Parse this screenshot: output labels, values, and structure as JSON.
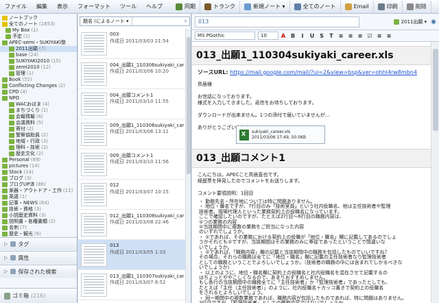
{
  "menu": [
    "ファイル",
    "編集",
    "表示",
    "フォーマット",
    "ツール",
    "ヘルプ"
  ],
  "toolbar": [
    {
      "label": "同期",
      "icon": "sync-icon",
      "color": "#5a8a3a"
    },
    {
      "label": "トランク",
      "icon": "trunk-icon",
      "color": "#7a5a2a"
    },
    {
      "label": "新規ノート ▾",
      "icon": "new-note-icon",
      "color": "#6a9ad0"
    },
    {
      "label": "全てのノート",
      "icon": "all-notes-icon",
      "color": "#5f7fa8"
    },
    {
      "label": "Email",
      "icon": "email-icon",
      "color": "#d0a040"
    },
    {
      "label": "印刷",
      "icon": "print-icon",
      "color": "#6a7b8c"
    },
    {
      "label": "削除",
      "icon": "delete-icon",
      "color": "#8a8a8a"
    }
  ],
  "tree": [
    {
      "label": "ノートブック",
      "indent": 0,
      "icon": "y",
      "count": "",
      "sel": false
    },
    {
      "label": "全てのノート",
      "indent": 0,
      "icon": "y",
      "count": "(1853)",
      "sel": false
    },
    {
      "label": "My Box",
      "indent": 1,
      "icon": "g",
      "count": "(1)",
      "sel": false
    },
    {
      "label": "予定",
      "indent": 1,
      "icon": "g",
      "count": "(1)",
      "sel": false
    },
    {
      "label": "APEC-semi・SUKIYAKI塾",
      "indent": 0,
      "icon": "g",
      "count": "",
      "sel": false
    },
    {
      "label": "2011出願",
      "indent": 2,
      "icon": "g",
      "count": "(7)",
      "sel": true
    },
    {
      "label": "base",
      "indent": 2,
      "icon": "g",
      "count": "(24)",
      "sel": false
    },
    {
      "label": "SUKIYAKI2010",
      "indent": 2,
      "icon": "g",
      "count": "(15)",
      "sel": false
    },
    {
      "label": "zemi2010",
      "indent": 2,
      "icon": "g",
      "count": "(12)",
      "sel": false
    },
    {
      "label": "管理",
      "indent": 2,
      "icon": "g",
      "count": "(1)",
      "sel": false
    },
    {
      "label": "Book",
      "indent": 0,
      "icon": "g",
      "count": "(52)",
      "sel": false
    },
    {
      "label": "Conflicting Changes",
      "indent": 0,
      "icon": "g",
      "count": "(2)",
      "sel": false
    },
    {
      "label": "CPD",
      "indent": 0,
      "icon": "g",
      "count": "(4)",
      "sel": false
    },
    {
      "label": "NPO",
      "indent": 0,
      "icon": "g",
      "count": "",
      "sel": false
    },
    {
      "label": "WACおばま",
      "indent": 2,
      "icon": "g",
      "count": "(4)",
      "sel": false
    },
    {
      "label": "まちづくり",
      "indent": 2,
      "icon": "g",
      "count": "(1)",
      "sel": false
    },
    {
      "label": "会報情報",
      "indent": 2,
      "icon": "g",
      "count": "(6)",
      "sel": false
    },
    {
      "label": "会議資料",
      "indent": 2,
      "icon": "g",
      "count": "(5)",
      "sel": false
    },
    {
      "label": "寄付",
      "indent": 2,
      "icon": "g",
      "count": "(2)",
      "sel": false
    },
    {
      "label": "警察協助員",
      "indent": 2,
      "icon": "g",
      "count": "(2)",
      "sel": false
    },
    {
      "label": "地域・行政",
      "indent": 2,
      "icon": "g",
      "count": "(3)",
      "sel": false
    },
    {
      "label": "理科・技術",
      "indent": 2,
      "icon": "g",
      "count": "(2)",
      "sel": false
    },
    {
      "label": "歴史文化",
      "indent": 2,
      "icon": "g",
      "count": "(2)",
      "sel": false
    },
    {
      "label": "Personal",
      "indent": 0,
      "icon": "g",
      "count": "(89)",
      "sel": false
    },
    {
      "label": "pictures",
      "indent": 0,
      "icon": "g",
      "count": "(14)",
      "sel": false
    },
    {
      "label": "Stock",
      "indent": 0,
      "icon": "g",
      "count": "(14)",
      "sel": false
    },
    {
      "label": "ブログ",
      "indent": 0,
      "icon": "g",
      "count": "(3)",
      "sel": false
    },
    {
      "label": "ブログUP済",
      "indent": 0,
      "icon": "g",
      "count": "(86)",
      "sel": false
    },
    {
      "label": "楽器・アウトドア・工作",
      "indent": 0,
      "icon": "g",
      "count": "(11)",
      "sel": false
    },
    {
      "label": "英語",
      "indent": 0,
      "icon": "g",
      "count": "(1)",
      "sel": false
    },
    {
      "label": "記事・NEWS",
      "indent": 0,
      "icon": "g",
      "count": "(64)",
      "sel": false
    },
    {
      "label": "技術・資格",
      "indent": 0,
      "icon": "g",
      "count": "(3)",
      "sel": false
    },
    {
      "label": "小説歴史資料",
      "indent": 0,
      "icon": "g",
      "count": "(3)",
      "sel": false
    },
    {
      "label": "説明書・各種書類",
      "indent": 0,
      "icon": "g",
      "count": "(2)",
      "sel": false
    },
    {
      "label": "名刺",
      "indent": 0,
      "icon": "g",
      "count": "(7)",
      "sel": false
    },
    {
      "label": "歴史・観光",
      "indent": 0,
      "icon": "g",
      "count": "(6)",
      "sel": false
    }
  ],
  "sections": [
    {
      "label": "タグ",
      "icon": "tag-icon"
    },
    {
      "label": "属性",
      "icon": "attribute-icon"
    },
    {
      "label": "保存された検索",
      "icon": "saved-search-icon"
    }
  ],
  "trash": {
    "label": "ゴミ箱",
    "count": "(216)"
  },
  "sort_label": "題名 (によるノート ▾",
  "notes": [
    {
      "title": "003",
      "date": "作成日 2011/03/03 21:54",
      "sel": false
    },
    {
      "title": "004_出願1_110306sukiyaki_career...",
      "date": "作成日 2011/03/06 10:20",
      "sel": false
    },
    {
      "title": "004_出願コメント1",
      "date": "作成日 2011/03/10 11:55",
      "sel": false
    },
    {
      "title": "009_出願1_110306sukiyaki_career(...",
      "date": "作成日 2011/03/06 13:11",
      "sel": false
    },
    {
      "title": "009_出願コメント1",
      "date": "作成日 2011/03/10 11:56",
      "sel": false
    },
    {
      "title": "012",
      "date": "作成日 2011/03/07 10:15",
      "sel": false
    },
    {
      "title": "012_出願1_110308sukiyaki_career...",
      "date": "作成日 2011/03/08 22:46",
      "sel": false
    },
    {
      "title": "013",
      "date": "作成日 2011/03/05 1:10",
      "sel": true
    },
    {
      "title": "013_出願1_110307sukiyaki_career...",
      "date": "作成日 2011/03/07 8:52",
      "sel": false
    }
  ],
  "editor": {
    "note_title": "013",
    "notebook": "2011出願 ▾",
    "font": "MS PGothic",
    "size": "10",
    "format_buttons": [
      "A",
      "B",
      "I",
      "U",
      "S",
      "T",
      "≡",
      "≡",
      "≡",
      "☑",
      "≡",
      "≡"
    ],
    "h1a": "013_出願1_110304sukiyaki_career.xls",
    "source_label": "ソースURL:",
    "source_url": "https://mail.google.com/mail/?ui=2&view=bsp&ver=ohhl4rw8mbn4",
    "lines1": [
      "鳥居様",
      "",
      "お世話になっております。",
      "様式を入力してきました。返信をお待ちしております。",
      "",
      "ダウンロードが出来ません。1つの添付で届いていませんが...",
      "",
      "ありがとうございました。"
    ],
    "attach_name": "sukiyaki_career.xls",
    "attach_info": "2011/03/06 17:49, 50.0KB",
    "h1b": "013_出願コメント1",
    "lines2": [
      "こんにちは。APECこと鳥居直也です。",
      "経歴票を拝見したのでコメントをお送りします。",
      "",
      "コメント要領説明：1回目"
    ],
    "bullets": [
      "・ 勤務先名・所在地については特に問題ありません。",
      "・ 地位・職名ですが、7行目のみ「技術室員」という社内役職名、他は主任技術者や監理",
      "  技術者、現場代理人といった業務契約上の役職名になっています。",
      "  ここで確認したいのですが、たとえば2行目〜6行目の職務内容は、",
      "    ①つの業務の内容",
      "    ②当該期間中に複数の業務をご担当になった内容",
      "  のいずれでしょうか。",
      "・ ①であれば、その業務における契約上の役職が「地位・職名」欄に記載してあるのでしょ",
      "  うかそれとも②ですが、当該期間はその業務のみに専従であったということで間違いな",
      "  いでしょうか。",
      "・ ②であれば、「職務内容」欄の記載と当該期間中の職務を包括したものでいいですね？",
      "  その場合、それらの職務は全てに「地位・職名」欄に記載の主任技術者なり監理技術者",
      "  としての職務ということでよろしいでしょうか。（技術者の職務の中には含まれてしかるべきな",
      "  いでしょうか）",
      "・ 以上のように、地位・職名欄に契約上の役職名と社内役職名を混在させて記載するの",
      "  はちょっとややこしくなるので、あまりおすすめしません。",
      "  もし各行の当該期間中の職務全てに「主任技術者」か「監理技術者」であったとしても、",
      "  たとえば「主任（主任技術者）」のように、社内役職名＋カッコ書きで契約上の役職名",
      "  をされるとよろしいでしょう。",
      "・ 同一期間中の複数業務であれば、職務内容が包括したものであれば、特に問題はありません。",
      "  3行目ですが、「監理技術者」としての職務内容ではないでしょうか。"
    ]
  }
}
